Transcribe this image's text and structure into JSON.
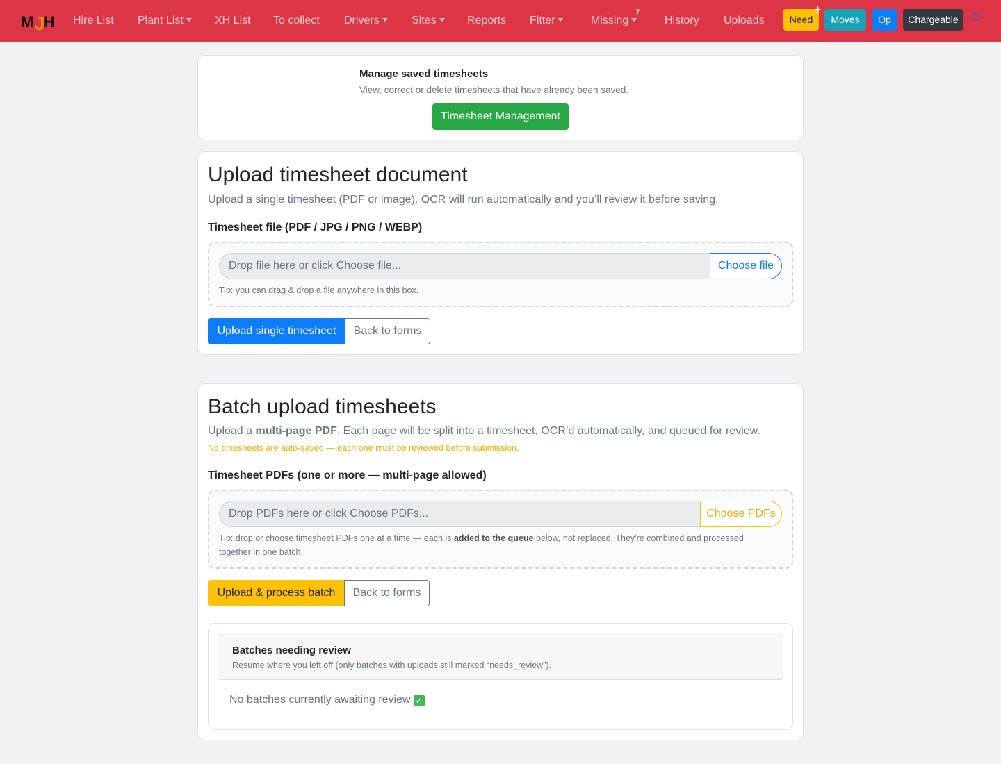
{
  "nav": {
    "items": [
      "Hire List",
      "Plant List",
      "XH List",
      "To collect",
      "Drivers",
      "Sites",
      "Reports",
      "Fitter",
      "Missing",
      "History",
      "Uploads"
    ],
    "missing_count": "7",
    "buttons": [
      "Need",
      "Moves",
      "Op",
      "Chargeable"
    ],
    "plus": "+",
    "colors": {
      "navbar": "#dc3545",
      "need": "#ffc107",
      "moves": "#17a2b8",
      "op": "#0d7cf7",
      "chargeable": "#343a40"
    }
  },
  "manage": {
    "title": "Manage saved timesheets",
    "subtitle": "View, correct or delete timesheets that have already been saved.",
    "button": "Timesheet Management"
  },
  "single": {
    "title": "Upload timesheet document",
    "lead": "Upload a single timesheet (PDF or image). OCR will run automatically and you’ll review it before saving.",
    "label": "Timesheet file (PDF / JPG / PNG / WEBP)",
    "placeholder": "Drop file here or click Choose file...",
    "choose": "Choose file",
    "tip": "Tip: you can drag & drop a file anywhere in this box.",
    "upload_button": "Upload single timesheet",
    "back_button": "Back to forms"
  },
  "batch": {
    "title": "Batch upload timesheets",
    "lead_a": "Upload a ",
    "lead_bold": "multi-page PDF",
    "lead_b": ". Each page will be split into a timesheet, OCR’d automatically, and queued for review.",
    "warning": "No timesheets are auto-saved — each one must be reviewed before submission.",
    "label": "Timesheet PDFs (one or more — multi-page allowed)",
    "placeholder": "Drop PDFs here or click Choose PDFs...",
    "choose": "Choose PDFs",
    "tip_a": "Tip: drop or choose timesheet PDFs one at a time — each is ",
    "tip_bold": "added to the queue",
    "tip_b": " below, not replaced. They're combined and processed",
    "tip_c": "together in one batch.",
    "upload_button": "Upload & process batch",
    "back_button": "Back to forms"
  },
  "review": {
    "title": "Batches needing review",
    "subtitle": "Resume where you left off (only batches with uploads still marked “needs_review”).",
    "empty": "No batches currently awaiting review",
    "check": "✓"
  }
}
